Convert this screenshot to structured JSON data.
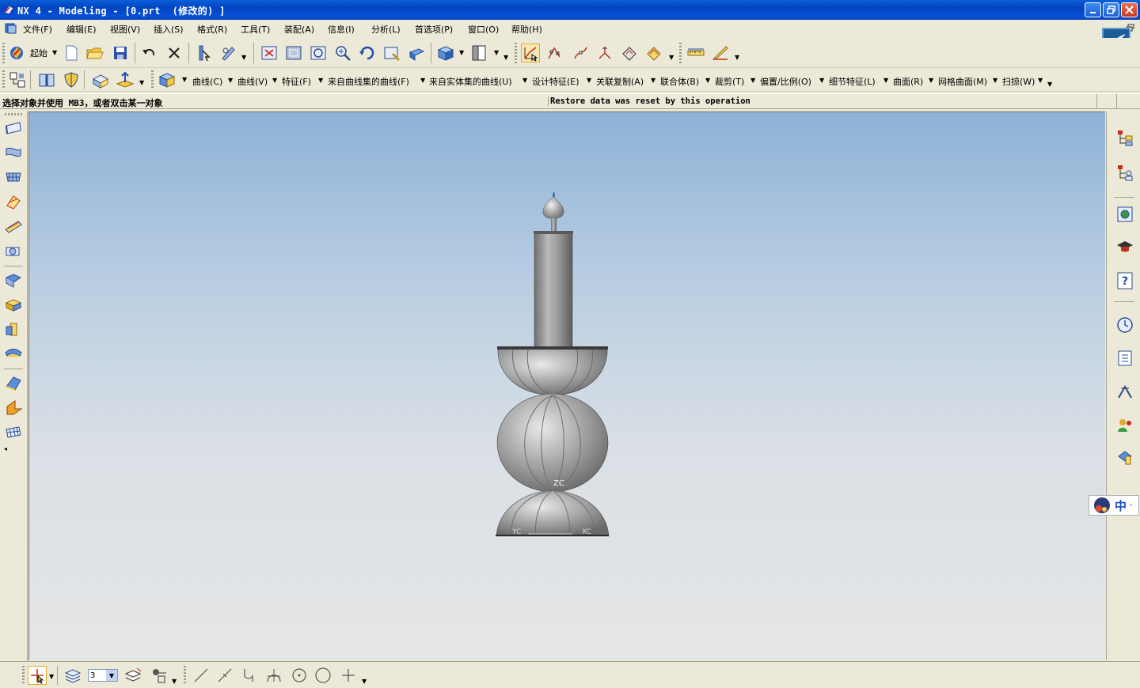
{
  "window": {
    "title": "NX 4 - Modeling - [0.prt  (修改的) ]"
  },
  "menu": {
    "items": [
      "文件(F)",
      "编辑(E)",
      "视图(V)",
      "插入(S)",
      "格式(R)",
      "工具(T)",
      "装配(A)",
      "信息(I)",
      "分析(L)",
      "首选项(P)",
      "窗口(O)",
      "帮助(H)"
    ]
  },
  "toolbar_standard": {
    "start_label": "起始"
  },
  "toolbar_feature": {
    "menus": [
      "曲线(C)",
      "曲线(V)",
      "特征(F)",
      "来自曲线集的曲线(F)",
      "来自实体集的曲线(U)",
      "设计特征(E)",
      "关联复制(A)",
      "联合体(B)",
      "裁剪(T)",
      "偏置/比例(O)",
      "细节特征(L)",
      "曲面(R)",
      "网格曲面(M)",
      "扫掠(W)"
    ]
  },
  "status": {
    "prompt": "选择对象并使用 MB3，或者双击某一对象",
    "message": "Restore data was reset by this operation"
  },
  "viewport": {
    "triad": {
      "z": "ZC",
      "y": "YC",
      "x": "XC"
    }
  },
  "bottom_toolbar": {
    "layer_value": "3"
  },
  "ime": {
    "label": "中"
  },
  "colors": {
    "titlebar": "#0A5FD8",
    "background_top": "#8DB2D6",
    "background_bottom": "#E5E6E6",
    "model_shade": "#A8A8A8"
  },
  "icons": {
    "left_toolbar": [
      "extrude-icon",
      "revolve-icon",
      "sweep-icon",
      "rotate-icon",
      "chamfer-icon",
      "section-icon",
      "pattern-icon",
      "block-icon",
      "cylinder-icon",
      "hole-icon",
      "blend-icon",
      "offset-icon",
      "mesh-icon"
    ],
    "right_bar": [
      "assembly-navigator-icon",
      "part-navigator-icon",
      "web-browser-icon",
      "training-icon",
      "help-icon",
      "history-icon",
      "system-materials-icon",
      "process-studio-icon",
      "roles-icon",
      "manufacturing-icon"
    ]
  }
}
